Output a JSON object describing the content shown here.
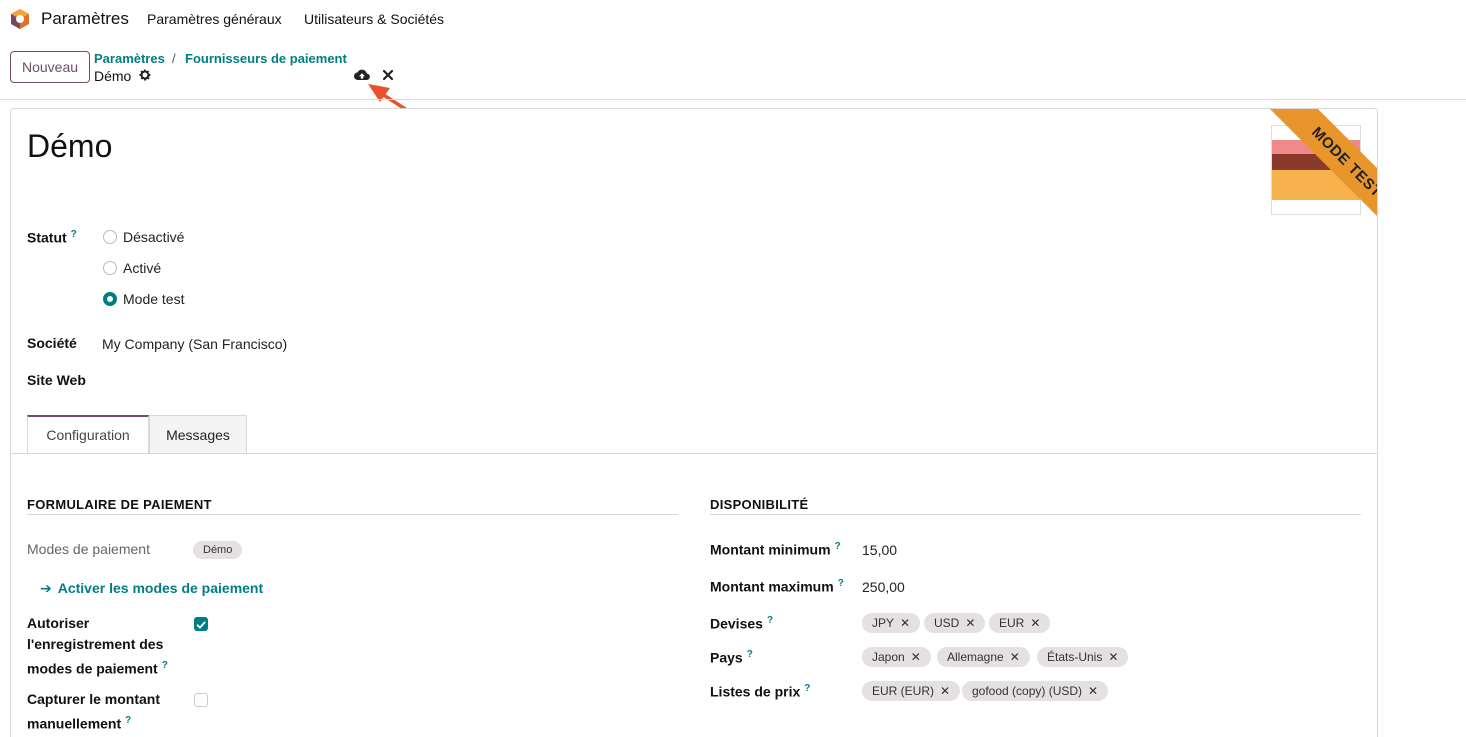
{
  "navbar": {
    "app_name": "Paramètres",
    "menu": [
      "Paramètres généraux",
      "Utilisateurs & Sociétés"
    ]
  },
  "control_panel": {
    "new_button": "Nouveau",
    "breadcrumb": [
      "Paramètres",
      "Fournisseurs de paiement"
    ],
    "separator": "/",
    "current": "Démo"
  },
  "form": {
    "title": "Démo",
    "ribbon": "MODE TEST",
    "status": {
      "label": "Statut",
      "help": "?",
      "options": [
        "Désactivé",
        "Activé",
        "Mode test"
      ],
      "selected": "Mode test"
    },
    "company": {
      "label": "Société",
      "value": "My Company (San Francisco)"
    },
    "website": {
      "label": "Site Web",
      "value": ""
    },
    "tabs": [
      "Configuration",
      "Messages"
    ],
    "active_tab": "Configuration",
    "payment_form": {
      "section_title": "FORMULAIRE DE PAIEMENT",
      "methods_label": "Modes de paiement",
      "methods_tags": [
        "Démo"
      ],
      "activate_link": "Activer les modes de paiement",
      "allow_tokenization": {
        "lines": [
          "Autoriser",
          "l'enregistrement des",
          "modes de paiement"
        ],
        "checked": true
      },
      "capture_manually": {
        "lines": [
          "Capturer le montant",
          "manuellement"
        ],
        "checked": false
      }
    },
    "availability": {
      "section_title": "DISPONIBILITÉ",
      "min_label": "Montant minimum",
      "min_value": "15,00",
      "max_label": "Montant maximum",
      "max_value": "250,00",
      "currencies_label": "Devises",
      "currencies": [
        "JPY",
        "USD",
        "EUR"
      ],
      "countries_label": "Pays",
      "countries": [
        "Japon",
        "Allemagne",
        "États-Unis"
      ],
      "pricelists_label": "Listes de prix",
      "pricelists": [
        "EUR (EUR)",
        "gofood (copy) (USD)"
      ]
    }
  },
  "colors": {
    "brand": "#714b67",
    "accent": "#017e84",
    "ribbon": "#e8962c",
    "arrow": "#e8532f"
  },
  "icons": {
    "logo": "odoo-logo-icon",
    "gear": "gear-icon",
    "save": "cloud-upload-icon",
    "discard": "close-icon",
    "link_arrow": "arrow-right-icon",
    "tag_remove": "close-icon"
  }
}
